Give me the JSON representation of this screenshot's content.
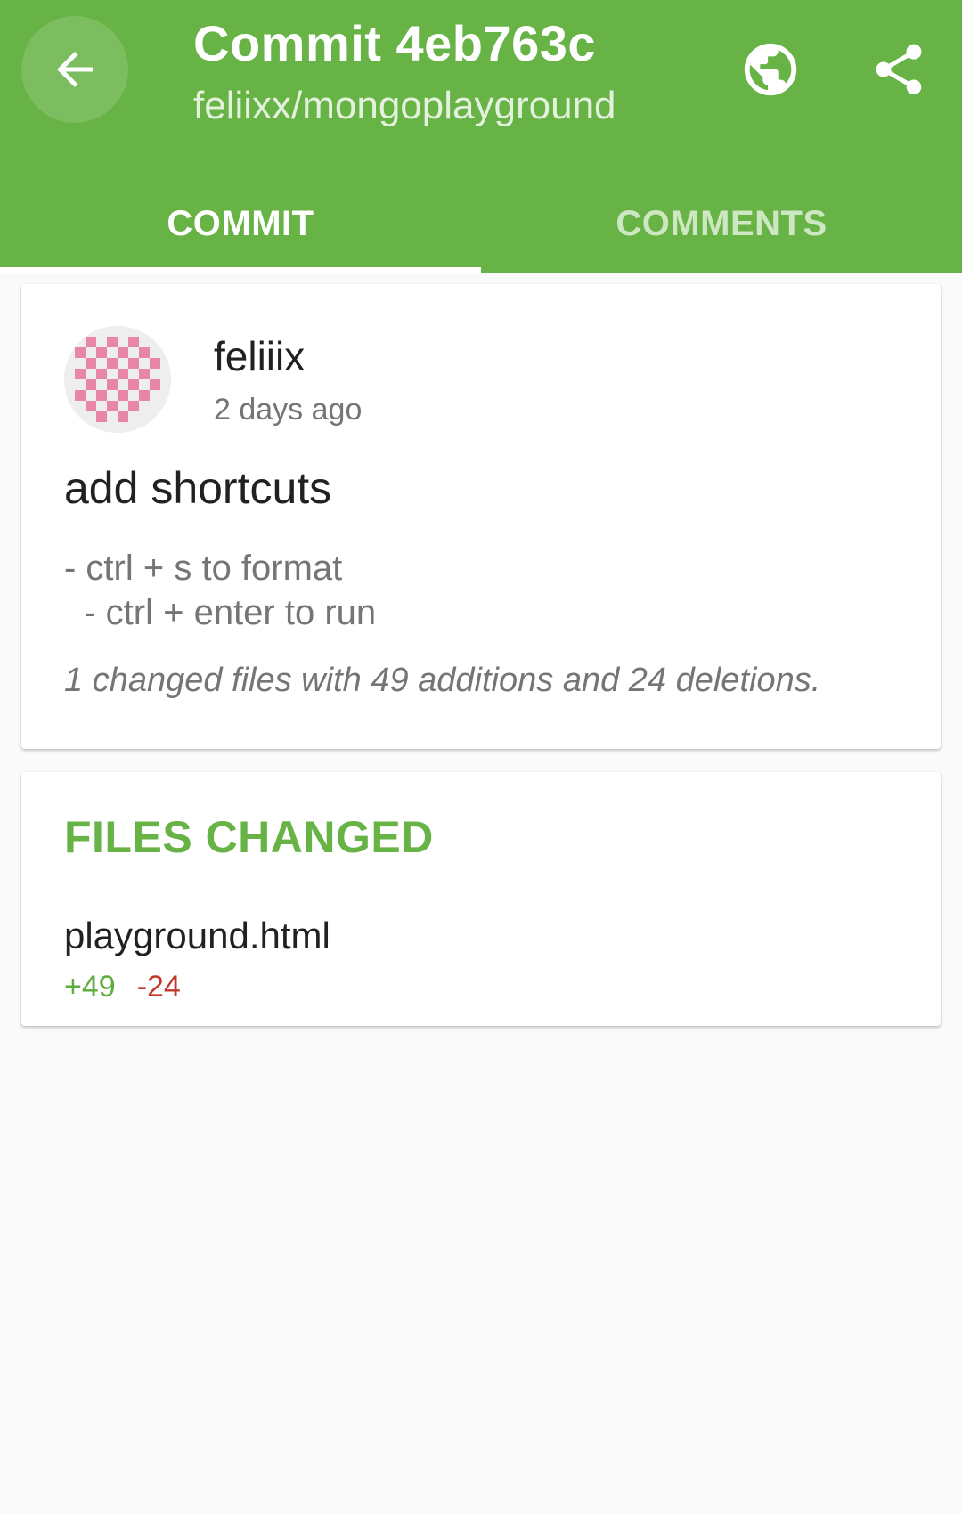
{
  "appbar": {
    "title": "Commit 4eb763c",
    "subtitle": "feliixx/mongoplayground",
    "icons": {
      "back": "arrow-back-icon",
      "globe": "globe-icon",
      "share": "share-icon"
    },
    "color": "#67b345"
  },
  "tabs": [
    {
      "label": "COMMIT",
      "active": true
    },
    {
      "label": "COMMENTS",
      "active": false
    }
  ],
  "commit": {
    "author": "feliiix",
    "time": "2 days ago",
    "title": "add shortcuts",
    "body": "- ctrl + s to format\n  - ctrl + enter to run",
    "summary": "1 changed files with 49 additions and 24 deletions.",
    "avatar_colors": {
      "primary": "#e886a9",
      "secondary": "#eeeeee"
    }
  },
  "files": {
    "header": "FILES CHANGED",
    "items": [
      {
        "name": "playground.html",
        "additions": "+49",
        "deletions": "-24"
      }
    ]
  },
  "colors": {
    "additions": "#5fac3f",
    "deletions": "#c0392b"
  }
}
